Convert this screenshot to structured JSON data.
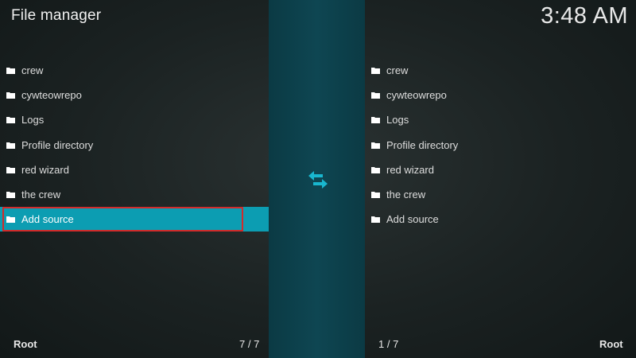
{
  "header": {
    "title": "File manager",
    "clock": "3:48 AM"
  },
  "left_pane": {
    "items": [
      {
        "label": "crew",
        "icon": "folder-icon"
      },
      {
        "label": "cywteowrepo",
        "icon": "folder-icon"
      },
      {
        "label": "Logs",
        "icon": "folder-icon"
      },
      {
        "label": "Profile directory",
        "icon": "folder-icon"
      },
      {
        "label": "red wizard",
        "icon": "folder-icon"
      },
      {
        "label": "the crew",
        "icon": "folder-icon"
      },
      {
        "label": "Add source",
        "icon": "folder-icon",
        "selected": true
      }
    ],
    "footer_location": "Root",
    "footer_count": "7 / 7"
  },
  "right_pane": {
    "items": [
      {
        "label": "crew",
        "icon": "folder-icon"
      },
      {
        "label": "cywteowrepo",
        "icon": "folder-icon"
      },
      {
        "label": "Logs",
        "icon": "folder-icon"
      },
      {
        "label": "Profile directory",
        "icon": "folder-icon"
      },
      {
        "label": "red wizard",
        "icon": "folder-icon"
      },
      {
        "label": "the crew",
        "icon": "folder-icon"
      },
      {
        "label": "Add source",
        "icon": "folder-icon"
      }
    ],
    "footer_location": "Root",
    "footer_count": "1 / 7"
  },
  "center": {
    "icon": "swap-arrows-icon"
  },
  "colors": {
    "selection": "#0c9db2",
    "highlight_border": "#d22b2b",
    "center_band": "#0e4652",
    "swap_icon": "#19b7cf"
  }
}
